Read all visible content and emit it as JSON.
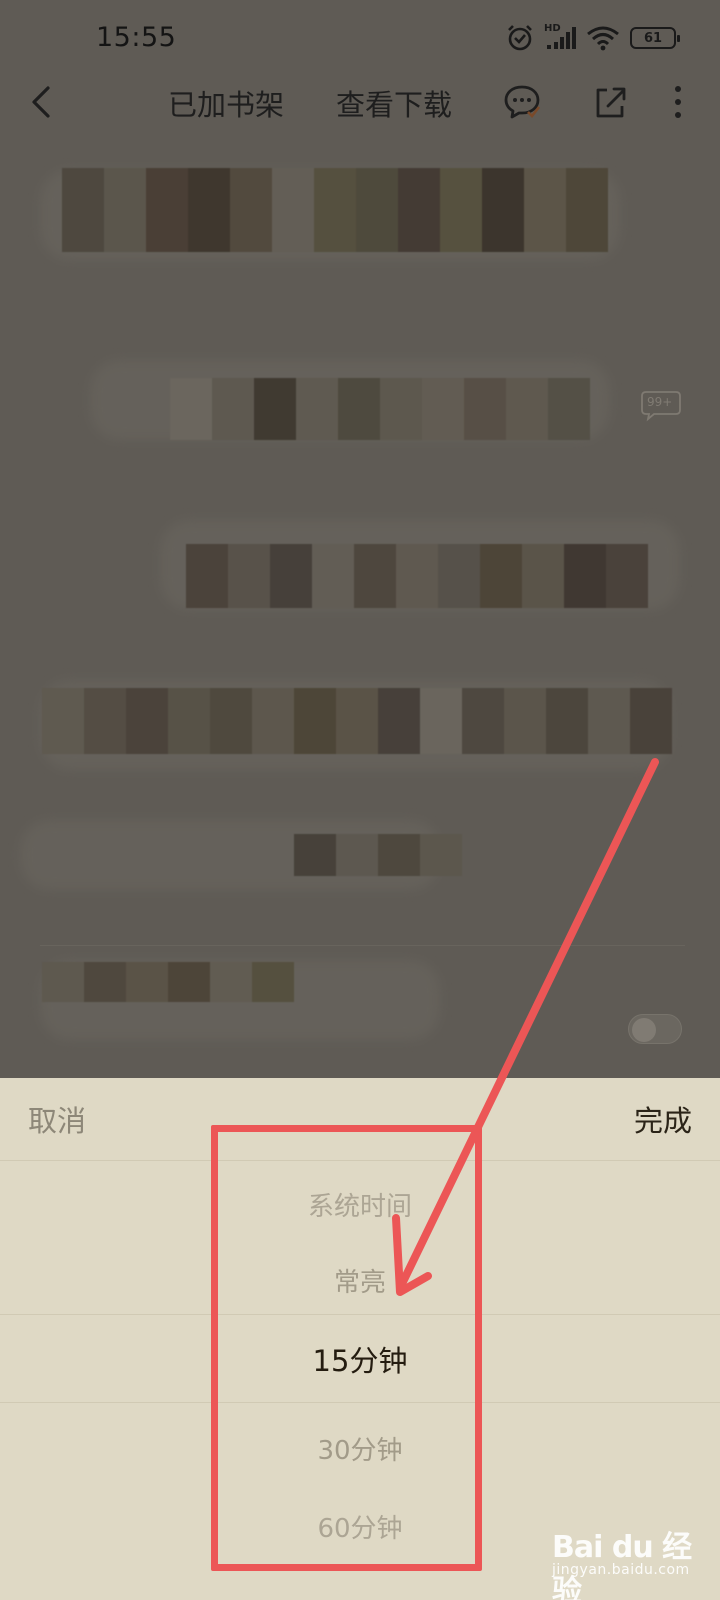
{
  "status_bar": {
    "time": "15:55",
    "network_label": "HD",
    "battery_level": "61",
    "icons": [
      "alarm-icon",
      "cellular-signal-icon",
      "wifi-icon",
      "battery-icon"
    ]
  },
  "top_nav": {
    "added_to_shelf": "已加书架",
    "view_download": "查看下载",
    "icons": [
      "back-arrow-icon",
      "comment-icon",
      "share-icon",
      "more-vertical-icon"
    ]
  },
  "content": {
    "comment_badge": "99+"
  },
  "bottom_sheet": {
    "cancel_label": "取消",
    "done_label": "完成",
    "options": [
      "系统时间",
      "常亮",
      "15分钟",
      "30分钟",
      "60分钟"
    ],
    "selected_option": "15分钟"
  },
  "annotation": {
    "highlight_color": "#ec5656"
  },
  "watermark": {
    "brand": "Bai du 经验",
    "site": "jingyan.baidu.com"
  },
  "colors": {
    "dim_overlay": "#5f5b55",
    "sheet_background": "#dfd9c5",
    "selected_text": "#241c10",
    "muted_text": "#aca594"
  }
}
